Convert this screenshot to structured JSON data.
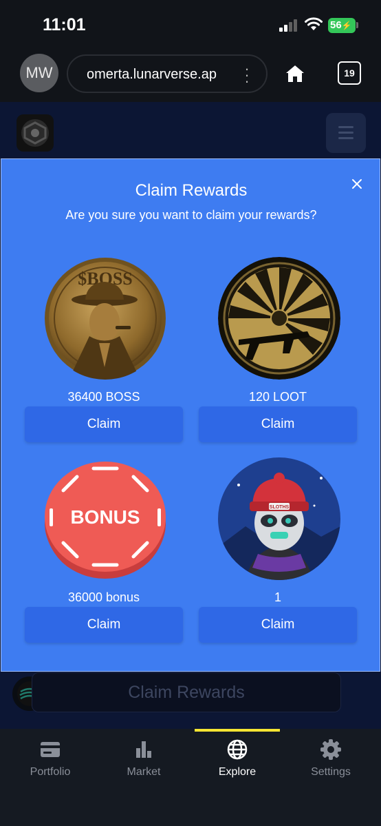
{
  "status_bar": {
    "time": "11:01",
    "battery": "56"
  },
  "browser": {
    "avatar_initials": "MW",
    "url": "omerta.lunarverse.ap",
    "tab_count": "19"
  },
  "modal": {
    "title": "Claim Rewards",
    "subtitle": "Are you sure you want to claim your rewards?",
    "rewards": [
      {
        "label": "36400 BOSS",
        "button": "Claim",
        "coin_text": "$BOSS"
      },
      {
        "label": "120 LOOT",
        "button": "Claim"
      },
      {
        "label": "36000 bonus",
        "button": "Claim",
        "chip_text": "BONUS"
      },
      {
        "label": "1",
        "button": "Claim",
        "hat_text": "SLOTHS"
      }
    ]
  },
  "background": {
    "claim_button": "Claim Rewards"
  },
  "nav": {
    "items": [
      {
        "label": "Portfolio",
        "icon": "wallet-icon"
      },
      {
        "label": "Market",
        "icon": "bar-chart-icon"
      },
      {
        "label": "Explore",
        "icon": "globe-icon",
        "active": true
      },
      {
        "label": "Settings",
        "icon": "gear-icon"
      }
    ]
  },
  "colors": {
    "modal_bg": "#3e7cf1",
    "claim_button": "#2f68e6",
    "nav_active_indicator": "#f5e532",
    "page_bg": "#0c1634"
  }
}
